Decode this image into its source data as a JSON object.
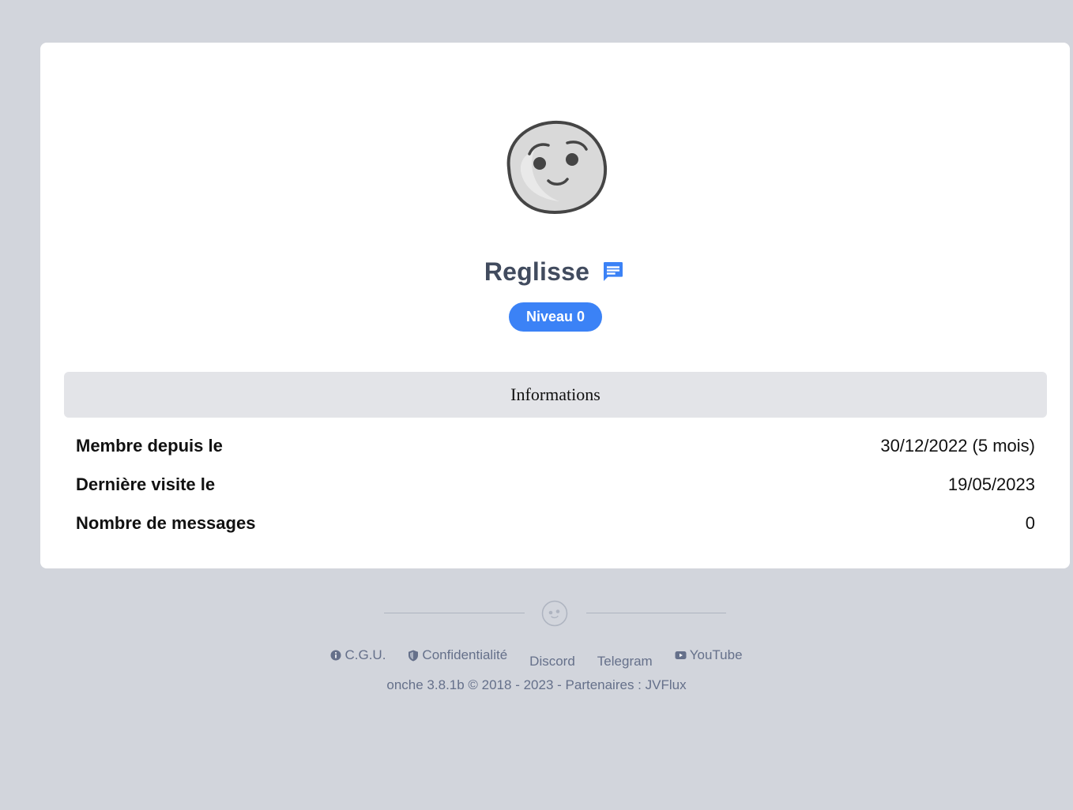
{
  "profile": {
    "username": "Reglisse",
    "level_label": "Niveau 0"
  },
  "info": {
    "title": "Informations",
    "rows": [
      {
        "label": "Membre depuis le",
        "value": "30/12/2022 (5 mois)"
      },
      {
        "label": "Dernière visite le",
        "value": "19/05/2023"
      },
      {
        "label": "Nombre de messages",
        "value": "0"
      }
    ]
  },
  "footer": {
    "links": [
      {
        "label": "C.G.U.",
        "icon": "info-icon"
      },
      {
        "label": "Confidentialité",
        "icon": "shield-icon"
      },
      {
        "label": "Discord"
      },
      {
        "label": "Telegram"
      },
      {
        "label": "YouTube",
        "icon": "youtube-icon"
      }
    ],
    "copyright_prefix": "onche 3.8.1b © 2018 - 2023 - Partenaires : ",
    "partner": "JVFlux"
  },
  "colors": {
    "background": "#d2d5dc",
    "card": "#ffffff",
    "accent": "#3b82f6",
    "username": "#414b5e",
    "footer_text": "#65708a"
  }
}
